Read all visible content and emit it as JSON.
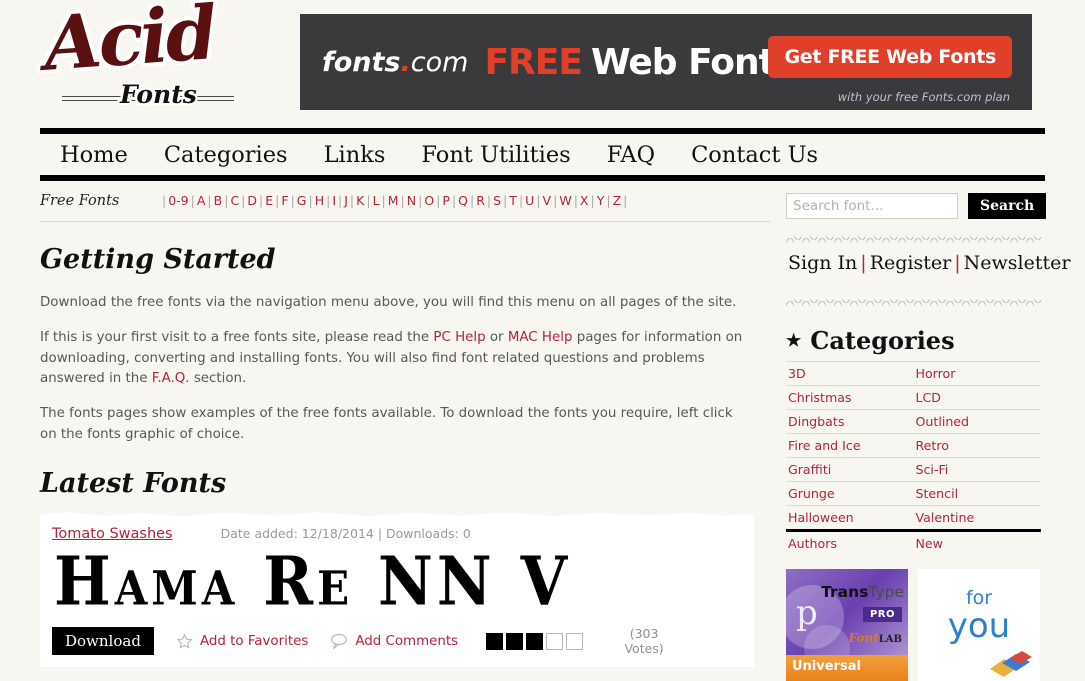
{
  "site": {
    "logo_main": "Acid",
    "logo_sub": "Fonts"
  },
  "banner_ad": {
    "brand": "fonts",
    "brand_dot": ".",
    "brand_tld": "com",
    "free": "FREE",
    "web_fonts": "Web Fonts",
    "cta": "Get FREE Web Fonts",
    "subtext": "with your free Fonts.com plan"
  },
  "nav": {
    "items": [
      {
        "label": "Home"
      },
      {
        "label": "Categories"
      },
      {
        "label": "Links"
      },
      {
        "label": "Font Utilities"
      },
      {
        "label": "FAQ"
      },
      {
        "label": "Contact Us"
      }
    ]
  },
  "alphabet": {
    "label": "Free Fonts",
    "items": [
      "0-9",
      "A",
      "B",
      "C",
      "D",
      "E",
      "F",
      "G",
      "H",
      "I",
      "J",
      "K",
      "L",
      "M",
      "N",
      "O",
      "P",
      "Q",
      "R",
      "S",
      "T",
      "U",
      "V",
      "W",
      "X",
      "Y",
      "Z"
    ],
    "separator": "|"
  },
  "getting_started": {
    "heading": "Getting Started",
    "p1": "Download the free fonts via the navigation menu above, you will find this menu on all pages of the site.",
    "p2_a": "If this is your first visit to a free fonts site, please read the ",
    "p2_link1": "PC Help",
    "p2_b": " or ",
    "p2_link2": "MAC Help",
    "p2_c": " pages for information on downloading, converting and installing fonts. You will also find font related questions and problems answered in the ",
    "p2_link3": "F.A.Q.",
    "p2_d": " section.",
    "p3": "The fonts pages show examples of the free fonts available. To download the fonts you require, left click on the fonts graphic of choice."
  },
  "latest_fonts": {
    "heading": "Latest Fonts",
    "cards": [
      {
        "name": "Tomato Swashes",
        "meta": "Date added: 12/18/2014  |  Downloads: 0",
        "preview_sample": "Hama Re NN V",
        "download_label": "Download",
        "favorites_label": "Add to Favorites",
        "comments_label": "Add Comments",
        "rating_filled": 3,
        "rating_total": 5,
        "votes": "(303 Votes)"
      }
    ]
  },
  "search": {
    "placeholder": "Search font...",
    "value": "",
    "button_label": "Search"
  },
  "account": {
    "sign_in": "Sign In",
    "register": "Register",
    "newsletter": "Newsletter",
    "divider": "|"
  },
  "categories": {
    "heading": "Categories",
    "star": "★",
    "rows": [
      {
        "left": "3D",
        "right": "Horror"
      },
      {
        "left": "Christmas",
        "right": "LCD"
      },
      {
        "left": "Dingbats",
        "right": "Outlined"
      },
      {
        "left": "Fire and Ice",
        "right": "Retro"
      },
      {
        "left": "Graffiti",
        "right": "Sci-Fi"
      },
      {
        "left": "Grunge",
        "right": "Stencil"
      },
      {
        "left": "Halloween",
        "right": "Valentine"
      },
      {
        "left": "Authors",
        "right": "New"
      }
    ]
  },
  "sidebar_ads": {
    "transtype": {
      "title_bold": "Trans",
      "title_light": "Type",
      "badge": "PRO",
      "vendor": "Font",
      "vendor_suffix": "LAB",
      "footer": "Universal"
    },
    "foryou": {
      "line1": "for",
      "line2": "you"
    }
  },
  "colors": {
    "link_red": "#b0253a",
    "accent_orange": "#e0402a",
    "logo_maroon": "#5a0f10",
    "page_bg": "#f7f6f0"
  }
}
